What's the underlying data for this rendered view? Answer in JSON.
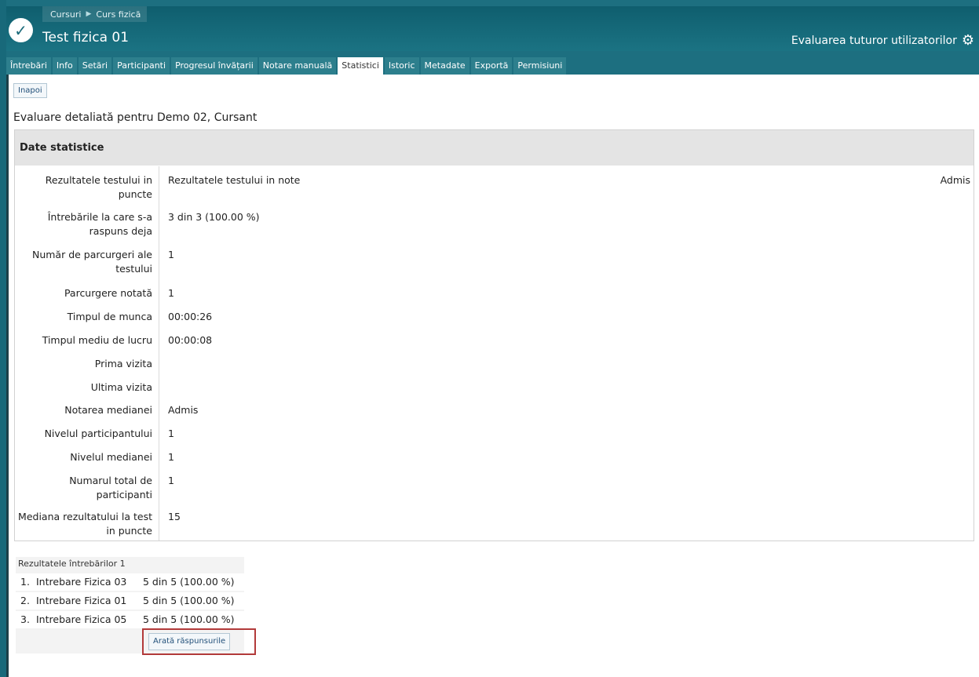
{
  "header": {
    "breadcrumbs": [
      "Cursuri",
      "Curs fizică"
    ],
    "title": "Test fizica 01",
    "right_label": "Evaluarea tuturor utilizatorilor"
  },
  "tabs": [
    {
      "label": "Întrebări"
    },
    {
      "label": "Info"
    },
    {
      "label": "Setări"
    },
    {
      "label": "Participanti"
    },
    {
      "label": "Progresul învățarii"
    },
    {
      "label": "Notare manuală"
    },
    {
      "label": "Statistici",
      "active": true
    },
    {
      "label": "Istoric"
    },
    {
      "label": "Metadate"
    },
    {
      "label": "Exportă"
    },
    {
      "label": "Permisiuni"
    }
  ],
  "main": {
    "back_label": "Inapoi",
    "eval_title": "Evaluare detaliată pentru Demo 02, Cursant",
    "stats_header": "Date statistice",
    "stats": [
      {
        "label": "Rezultatele testului in puncte",
        "value": "Rezultatele testului in note",
        "value_right": "Admis"
      },
      {
        "label": "Întrebările la care s-a raspuns deja",
        "value": "3 din 3 (100.00 %)"
      },
      {
        "label": "Număr de parcurgeri ale testului",
        "value": "1"
      },
      {
        "label": "Parcurgere notată",
        "value": "1"
      },
      {
        "label": "Timpul de munca",
        "value": "00:00:26"
      },
      {
        "label": "Timpul mediu de lucru",
        "value": "00:00:08"
      },
      {
        "label": "Prima vizita",
        "value": ""
      },
      {
        "label": "Ultima vizita",
        "value": ""
      },
      {
        "label": "Notarea medianei",
        "value": "Admis"
      },
      {
        "label": "Nivelul participantului",
        "value": "1"
      },
      {
        "label": "Nivelul medianei",
        "value": "1"
      },
      {
        "label": "Numarul total de participanti",
        "value": "1"
      },
      {
        "label": "Mediana rezultatului la test in puncte",
        "value": "15"
      }
    ],
    "results": {
      "caption": "Rezultatele întrebărilor 1",
      "rows": [
        {
          "num": "1.",
          "name": "Intrebare Fizica 03",
          "score": "5 din 5 (100.00 %)"
        },
        {
          "num": "2.",
          "name": "Intrebare Fizica 01",
          "score": "5 din 5 (100.00 %)"
        },
        {
          "num": "3.",
          "name": "Intrebare Fizica 05",
          "score": "5 din 5 (100.00 %)"
        }
      ],
      "button_label": "Arată răspunsurile"
    }
  },
  "icons": {
    "app": "check-circle-icon",
    "settings": "gear-icon",
    "breadcrumb_separator": "triangle-right-icon"
  },
  "colors": {
    "frame": "#1d6f80",
    "tab": "#2d7f8d",
    "highlight": "#b23a3a"
  }
}
